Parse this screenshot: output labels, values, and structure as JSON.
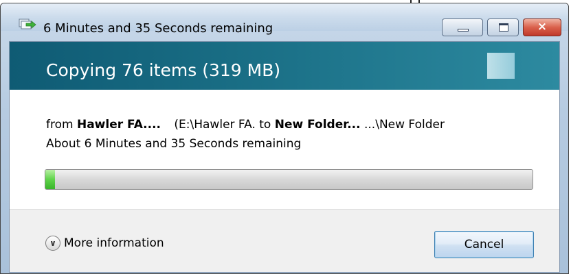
{
  "window": {
    "title": "6 Minutes and 35 Seconds remaining",
    "icon": "copy-progress-icon",
    "controls": {
      "minimize_icon": "minimize-icon",
      "maximize_icon": "maximize-icon",
      "close_symbol": "×"
    }
  },
  "banner": {
    "title": "Copying 76 items (319 MB)"
  },
  "details": {
    "from_prefix": "from",
    "source_name": "Hawler FA....",
    "source_path": "(E:\\Hawler FA. to",
    "dest_name": "New Folder...",
    "dest_path": "...\\New Folder",
    "time_remaining": "About 6 Minutes and 35 Seconds remaining"
  },
  "progress": {
    "fraction": 0.02,
    "fill_color": "#5fd34a"
  },
  "footer": {
    "more_info_icon": "chevron-down-icon",
    "more_info_label": "More information",
    "cancel_label": "Cancel"
  }
}
